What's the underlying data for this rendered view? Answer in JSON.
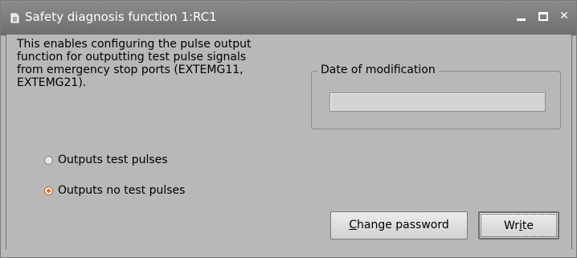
{
  "window": {
    "title": "Safety diagnosis function 1:RC1",
    "title_icon": "document-icon",
    "controls": [
      "minimize",
      "maximize",
      "close"
    ]
  },
  "description": "This enables configuring the pulse output\nfunction for outputting test pulse signals\nfrom emergency stop ports (EXTEMG11,\nEXTEMG21).",
  "options": [
    {
      "label": "Outputs test pulses",
      "checked": false
    },
    {
      "label": "Outputs no test pulses",
      "checked": true
    }
  ],
  "group": {
    "label": "Date of modification",
    "date_value": ""
  },
  "buttons": {
    "change_password": {
      "prefix": "",
      "mnemonic": "C",
      "rest": "hange password"
    },
    "write": {
      "prefix": "Wr",
      "mnemonic": "i",
      "rest": "te"
    }
  }
}
